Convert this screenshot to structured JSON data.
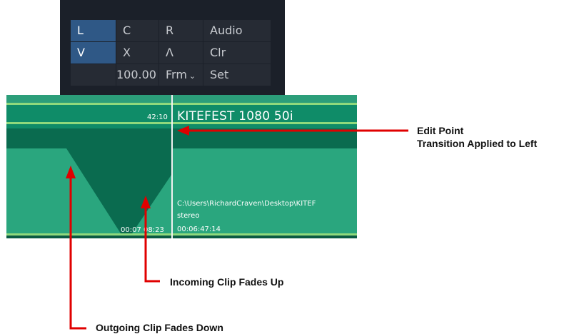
{
  "panel": {
    "rows": [
      [
        "L",
        "C",
        "R",
        "Audio"
      ],
      [
        "V",
        "X",
        "Λ",
        "Clr"
      ],
      [
        "",
        "100.00",
        "Frm",
        "Set"
      ]
    ]
  },
  "timeline": {
    "clip_name": "KITEFEST 1080 50i",
    "tc_top": "42:10",
    "path": "C:\\Users\\RichardCraven\\Desktop\\KITEF",
    "channel": "stereo",
    "tc_left": "00:07 08:23",
    "tc_right": "00:06:47:14"
  },
  "annotations": {
    "edit_point": "Edit Point",
    "transition_applied": "Transition Applied to Left",
    "incoming": "Incoming Clip Fades Up",
    "outgoing": "Outgoing Clip Fades Down"
  },
  "colors": {
    "panel_bg": "#1b2029",
    "active_cell": "#2f5886",
    "clip_green": "#2aa67e",
    "clip_dark": "#0a6b4f",
    "arrow_red": "#e00000"
  },
  "icons": {
    "dropdown": "chevron-down-icon"
  }
}
